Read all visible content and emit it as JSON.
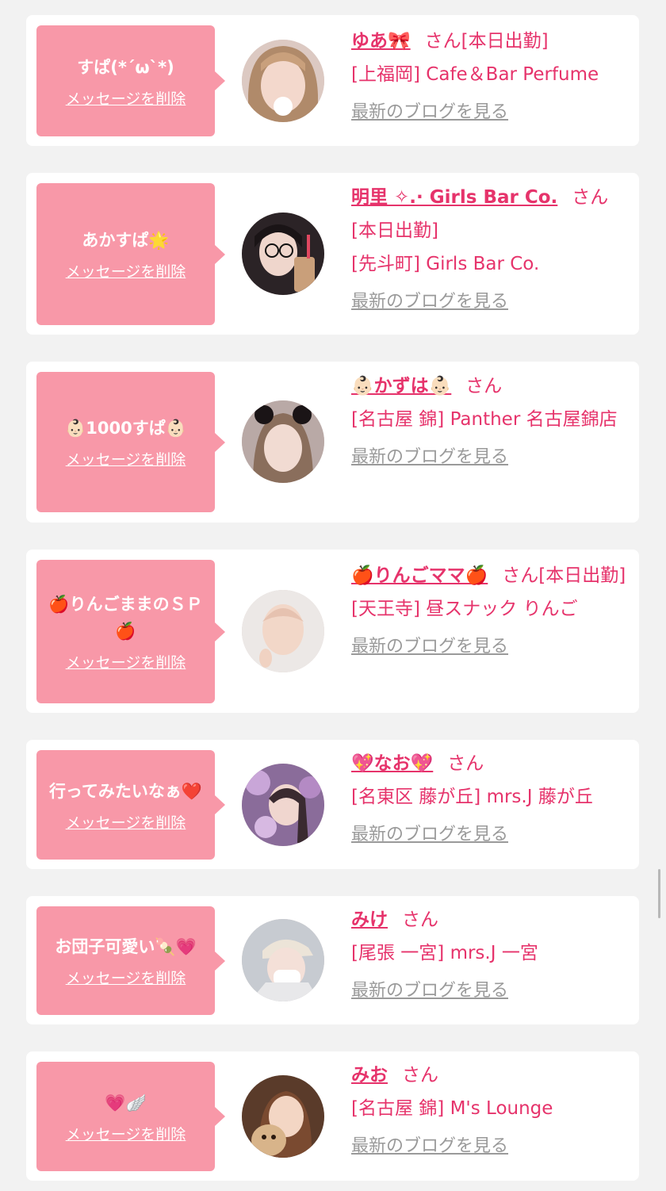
{
  "items": [
    {
      "message": "すぱ(*´ω`*)",
      "delete_label": "メッセージを削除",
      "name": "ゆあ🎀",
      "suffix": "さん",
      "line1": "[本日出勤]",
      "line2": "[上福岡] Cafe＆Bar Perfume",
      "blog_label": "最新のブログを見る",
      "avatar_bg": "#dcc9c2"
    },
    {
      "message": "あかすぱ🌟",
      "delete_label": "メッセージを削除",
      "name": "明里 ✧.· Girls Bar Co.",
      "suffix": "さん",
      "line1": "[本日出勤]",
      "line2": "[先斗町] Girls Bar Co.",
      "blog_label": "最新のブログを見る",
      "avatar_bg": "#2b2326"
    },
    {
      "message": "👶🏻1000すぱ👶🏻",
      "delete_label": "メッセージを削除",
      "name": "👶🏻かずは👶🏻",
      "suffix": "さん",
      "line1": "",
      "line2": "[名古屋 錦] Panther 名古屋錦店",
      "blog_label": "最新のブログを見る",
      "avatar_bg": "#b9a9a6"
    },
    {
      "message": "🍎りんごままのＳＰ🍎",
      "delete_label": "メッセージを削除",
      "name": "🍎りんごママ🍎",
      "suffix": "さん",
      "line1": "[本日出勤]",
      "line2": "[天王寺] 昼スナック りんご",
      "blog_label": "最新のブログを見る",
      "avatar_bg": "#ece8e6"
    },
    {
      "message": "行ってみたいなぁ❤️",
      "delete_label": "メッセージを削除",
      "name": "💖なお💖",
      "suffix": "さん",
      "line1": "",
      "line2": "[名東区 藤が丘] mrs.J 藤が丘",
      "blog_label": "最新のブログを見る",
      "avatar_bg": "#8a6c9a"
    },
    {
      "message": "お団子可愛い🍡💗",
      "delete_label": "メッセージを削除",
      "name": "みけ",
      "suffix": "さん",
      "line1": "",
      "line2": "[尾張 一宮] mrs.J 一宮",
      "blog_label": "最新のブログを見る",
      "avatar_bg": "#c7cbd1"
    },
    {
      "message": "💗🪽",
      "delete_label": "メッセージを削除",
      "name": "みお",
      "suffix": "さん",
      "line1": "",
      "line2": "[名古屋 錦] M's Lounge",
      "blog_label": "最新のブログを見る",
      "avatar_bg": "#5a3b2a"
    }
  ],
  "colors": {
    "bubble": "#f898a8",
    "accent": "#e6336b",
    "link_gray": "#9a9a9a",
    "page_bg": "#f2f2f2"
  }
}
